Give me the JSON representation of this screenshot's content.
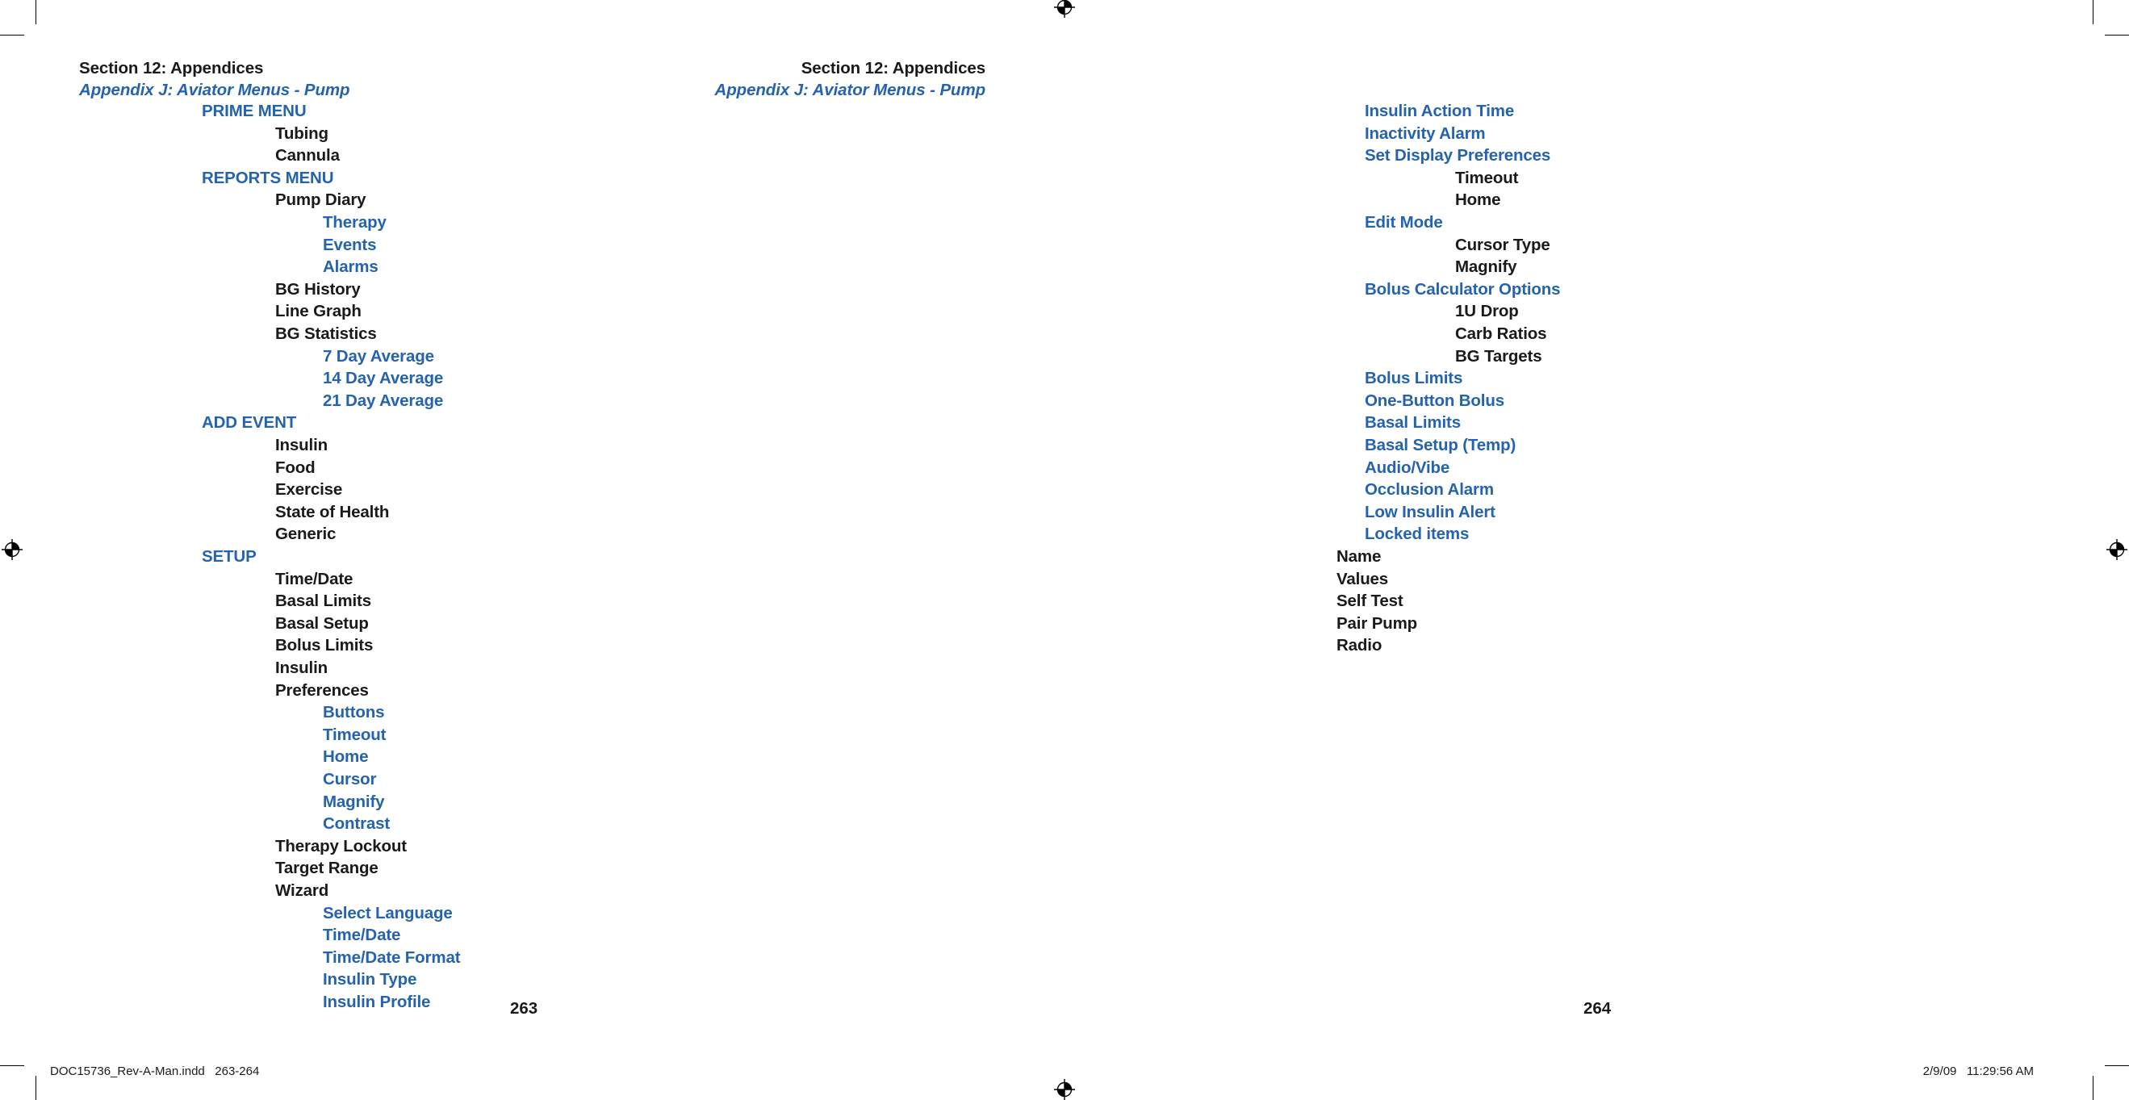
{
  "document": {
    "section_title": "Section 12: Appendices",
    "appendix_title": "Appendix J: Aviator Menus - Pump",
    "accent_color": "#2563ad",
    "text_color": "#1a1a1a"
  },
  "left_page": {
    "folio": "263",
    "head_section": "Section 12: Appendices",
    "head_appendix": "Appendix J: Aviator Menus - Pump",
    "menu_items": [
      {
        "label": "PRIME MENU",
        "level": 1,
        "color": "blue"
      },
      {
        "label": "Tubing",
        "level": 2,
        "color": "black"
      },
      {
        "label": "Cannula",
        "level": 2,
        "color": "black"
      },
      {
        "label": "REPORTS MENU",
        "level": 1,
        "color": "blue"
      },
      {
        "label": "Pump Diary",
        "level": 2,
        "color": "black"
      },
      {
        "label": "Therapy",
        "level": 3,
        "color": "blue"
      },
      {
        "label": "Events",
        "level": 3,
        "color": "blue"
      },
      {
        "label": "Alarms",
        "level": 3,
        "color": "blue"
      },
      {
        "label": "BG History",
        "level": 2,
        "color": "black"
      },
      {
        "label": "Line Graph",
        "level": 2,
        "color": "black"
      },
      {
        "label": "BG Statistics",
        "level": 2,
        "color": "black"
      },
      {
        "label": "7 Day Average",
        "level": 3,
        "color": "blue"
      },
      {
        "label": "14 Day Average",
        "level": 3,
        "color": "blue"
      },
      {
        "label": "21 Day Average",
        "level": 3,
        "color": "blue"
      },
      {
        "label": "ADD EVENT",
        "level": 1,
        "color": "blue"
      },
      {
        "label": "Insulin",
        "level": 2,
        "color": "black"
      },
      {
        "label": "Food",
        "level": 2,
        "color": "black"
      },
      {
        "label": "Exercise",
        "level": 2,
        "color": "black"
      },
      {
        "label": "State of Health",
        "level": 2,
        "color": "black"
      },
      {
        "label": "Generic",
        "level": 2,
        "color": "black"
      },
      {
        "label": "SETUP",
        "level": 1,
        "color": "blue"
      },
      {
        "label": "Time/Date",
        "level": 2,
        "color": "black"
      },
      {
        "label": "Basal Limits",
        "level": 2,
        "color": "black"
      },
      {
        "label": "Basal Setup",
        "level": 2,
        "color": "black"
      },
      {
        "label": "Bolus Limits",
        "level": 2,
        "color": "black"
      },
      {
        "label": "Insulin",
        "level": 2,
        "color": "black"
      },
      {
        "label": "Preferences",
        "level": 2,
        "color": "black"
      },
      {
        "label": "Buttons",
        "level": 3,
        "color": "blue"
      },
      {
        "label": "Timeout",
        "level": 3,
        "color": "blue"
      },
      {
        "label": "Home",
        "level": 3,
        "color": "blue"
      },
      {
        "label": "Cursor",
        "level": 3,
        "color": "blue"
      },
      {
        "label": "Magnify",
        "level": 3,
        "color": "blue"
      },
      {
        "label": "Contrast",
        "level": 3,
        "color": "blue"
      },
      {
        "label": "Therapy Lockout",
        "level": 2,
        "color": "black"
      },
      {
        "label": "Target Range",
        "level": 2,
        "color": "black"
      },
      {
        "label": "Wizard",
        "level": 2,
        "color": "black"
      },
      {
        "label": "Select Language",
        "level": 3,
        "color": "blue"
      },
      {
        "label": "Time/Date",
        "level": 3,
        "color": "blue"
      },
      {
        "label": "Time/Date Format",
        "level": 3,
        "color": "blue"
      },
      {
        "label": "Insulin Type",
        "level": 3,
        "color": "blue"
      },
      {
        "label": "Insulin Profile",
        "level": 3,
        "color": "blue"
      }
    ]
  },
  "right_page": {
    "folio": "264",
    "head_section": "Section 12: Appendices",
    "head_appendix": "Appendix J: Aviator Menus - Pump",
    "menu_items": [
      {
        "label": "Insulin Action Time",
        "level": 2,
        "color": "blue"
      },
      {
        "label": "Inactivity Alarm",
        "level": 2,
        "color": "blue"
      },
      {
        "label": "Set Display Preferences",
        "level": 2,
        "color": "blue"
      },
      {
        "label": "Timeout",
        "level": 3,
        "color": "black"
      },
      {
        "label": "Home",
        "level": 3,
        "color": "black"
      },
      {
        "label": "Edit Mode",
        "level": 2,
        "color": "blue"
      },
      {
        "label": "Cursor Type",
        "level": 3,
        "color": "black"
      },
      {
        "label": "Magnify",
        "level": 3,
        "color": "black"
      },
      {
        "label": "Bolus Calculator Options",
        "level": 2,
        "color": "blue"
      },
      {
        "label": "1U Drop",
        "level": 3,
        "color": "black"
      },
      {
        "label": "Carb Ratios",
        "level": 3,
        "color": "black"
      },
      {
        "label": "BG Targets",
        "level": 3,
        "color": "black"
      },
      {
        "label": "Bolus Limits",
        "level": 2,
        "color": "blue"
      },
      {
        "label": "One-Button Bolus",
        "level": 2,
        "color": "blue"
      },
      {
        "label": "Basal Limits",
        "level": 2,
        "color": "blue"
      },
      {
        "label": "Basal Setup (Temp)",
        "level": 2,
        "color": "blue"
      },
      {
        "label": "Audio/Vibe",
        "level": 2,
        "color": "blue"
      },
      {
        "label": "Occlusion Alarm",
        "level": 2,
        "color": "blue"
      },
      {
        "label": "Low Insulin Alert",
        "level": 2,
        "color": "blue"
      },
      {
        "label": "Locked items",
        "level": 2,
        "color": "blue"
      },
      {
        "label": "Name",
        "level": 1,
        "color": "black"
      },
      {
        "label": "Values",
        "level": 1,
        "color": "black"
      },
      {
        "label": "Self Test",
        "level": 1,
        "color": "black"
      },
      {
        "label": "Pair Pump",
        "level": 1,
        "color": "black"
      },
      {
        "label": "Radio",
        "level": 1,
        "color": "black"
      }
    ]
  },
  "print_slug": {
    "file_name": "DOC15736_Rev-A-Man.indd   263-264",
    "timestamp": "2/9/09   11:29:56 AM"
  }
}
